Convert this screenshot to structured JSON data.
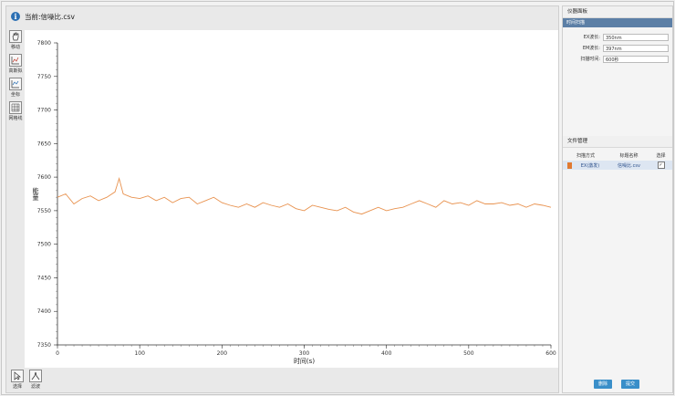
{
  "title": "当前:信噪比.csv",
  "left_toolbar": [
    {
      "label": "移动",
      "icon": "hand-icon"
    },
    {
      "label": "高斯拟",
      "icon": "chart-fit-icon"
    },
    {
      "label": "坐标",
      "icon": "axis-icon"
    },
    {
      "label": "网格线",
      "icon": "grid-icon"
    }
  ],
  "bottom_toolbar": [
    {
      "label": "选择",
      "icon": "select-icon"
    },
    {
      "label": "滤波",
      "icon": "peak-icon"
    }
  ],
  "params": {
    "section_title": "仪器面板",
    "sub_title": "时间扫描",
    "fields": [
      {
        "label": "EX波长:",
        "value": "350nm"
      },
      {
        "label": "EM波长:",
        "value": "397nm"
      },
      {
        "label": "扫描时间:",
        "value": "600秒"
      }
    ]
  },
  "files": {
    "section_title": "文件管理",
    "columns": [
      "扫描方式",
      "标题名称",
      "选择"
    ],
    "rows": [
      {
        "mode": "EX(激发)",
        "name": "信噪比.csv",
        "checked": "✓",
        "color": "#e07a32"
      }
    ]
  },
  "buttons": {
    "delete": "删除",
    "submit": "提交"
  },
  "chart_data": {
    "type": "line",
    "xlabel": "时间(s)",
    "ylabel": "能量",
    "xlim": [
      0,
      600
    ],
    "ylim": [
      7350,
      7800
    ],
    "x_ticks": [
      0,
      100,
      200,
      300,
      400,
      500,
      600
    ],
    "y_ticks": [
      7350,
      7400,
      7450,
      7500,
      7550,
      7600,
      7650,
      7700,
      7750,
      7800
    ],
    "series": [
      {
        "color": "#e8924f",
        "x": [
          0,
          10,
          20,
          30,
          40,
          50,
          60,
          70,
          75,
          80,
          90,
          100,
          110,
          120,
          130,
          140,
          150,
          160,
          170,
          180,
          190,
          200,
          210,
          220,
          230,
          240,
          250,
          260,
          270,
          280,
          290,
          300,
          310,
          320,
          330,
          340,
          350,
          360,
          370,
          380,
          390,
          400,
          410,
          420,
          430,
          440,
          450,
          460,
          470,
          480,
          490,
          500,
          510,
          520,
          530,
          540,
          550,
          560,
          570,
          580,
          590,
          600
        ],
        "values": [
          7570,
          7575,
          7560,
          7568,
          7572,
          7565,
          7570,
          7578,
          7598,
          7575,
          7570,
          7568,
          7572,
          7565,
          7570,
          7562,
          7568,
          7570,
          7560,
          7565,
          7570,
          7562,
          7558,
          7555,
          7560,
          7555,
          7562,
          7558,
          7555,
          7560,
          7553,
          7550,
          7558,
          7555,
          7552,
          7550,
          7555,
          7548,
          7545,
          7550,
          7555,
          7550,
          7553,
          7555,
          7560,
          7565,
          7560,
          7555,
          7565,
          7560,
          7562,
          7558,
          7565,
          7560,
          7560,
          7562,
          7558,
          7560,
          7555,
          7560,
          7558,
          7555
        ]
      }
    ]
  }
}
